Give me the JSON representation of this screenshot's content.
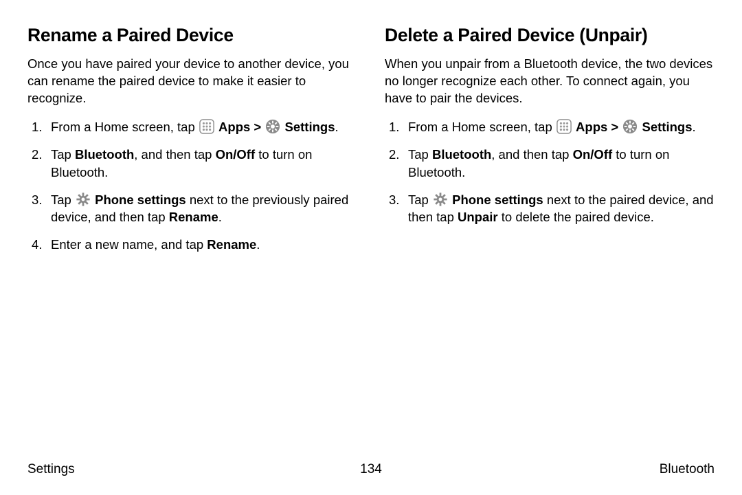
{
  "left": {
    "heading": "Rename a Paired Device",
    "intro": "Once you have paired your device to another device, you can rename the paired device to make it easier to recognize.",
    "steps": {
      "s1_pre": "From a Home screen, tap ",
      "s1_apps": "Apps",
      "s1_caret": " > ",
      "s1_settings": "Settings",
      "s1_post": ".",
      "s2_pre": "Tap ",
      "s2_bt": "Bluetooth",
      "s2_mid": ", and then tap ",
      "s2_onoff": "On/Off",
      "s2_post": " to turn on Bluetooth.",
      "s3_pre": "Tap ",
      "s3_ps": "Phone settings",
      "s3_mid": " next to the previously paired device, and then tap ",
      "s3_rename": "Rename",
      "s3_post": ".",
      "s4_pre": "Enter a new name, and tap ",
      "s4_rename": "Rename",
      "s4_post": "."
    }
  },
  "right": {
    "heading": "Delete a Paired Device (Unpair)",
    "intro": "When you unpair from a Bluetooth device, the two devices no longer recognize each other. To connect again, you have to pair the devices.",
    "steps": {
      "s1_pre": "From a Home screen, tap ",
      "s1_apps": "Apps",
      "s1_caret": " > ",
      "s1_settings": "Settings",
      "s1_post": ".",
      "s2_pre": "Tap ",
      "s2_bt": "Bluetooth",
      "s2_mid": ", and then tap ",
      "s2_onoff": "On/Off",
      "s2_post": " to turn on Bluetooth.",
      "s3_pre": "Tap ",
      "s3_ps": "Phone settings",
      "s3_mid": " next to the paired device, and then tap ",
      "s3_unpair": "Unpair",
      "s3_post": " to delete the paired device."
    }
  },
  "footer": {
    "left": "Settings",
    "center": "134",
    "right": "Bluetooth"
  }
}
